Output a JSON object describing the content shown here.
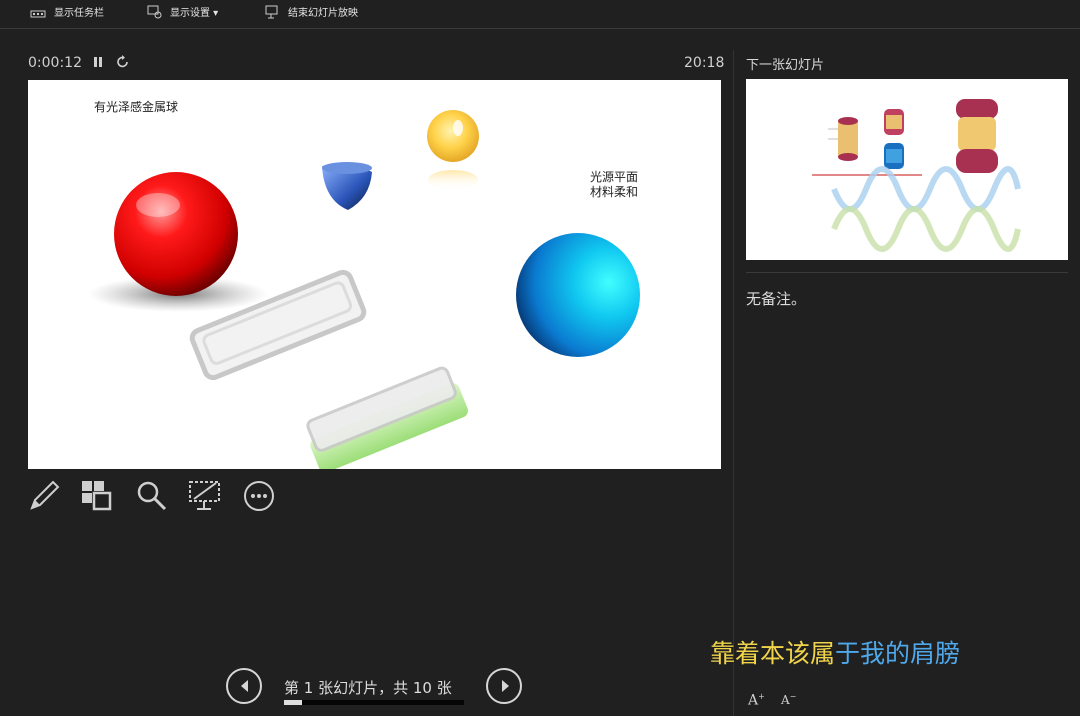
{
  "toolbar": {
    "show_taskbar": "显示任务栏",
    "display_settings": "显示设置 ▾",
    "end_show": "结束幻灯片放映"
  },
  "timer": {
    "elapsed": "0:00:12",
    "clock": "20:18"
  },
  "slide": {
    "label_metal": "有光泽感金属球",
    "label_light_1": "光源平面",
    "label_light_2": "材料柔和"
  },
  "tools": {
    "pen": "pen-icon",
    "slides": "all-slides-icon",
    "zoom": "zoom-icon",
    "screen": "black-screen-icon",
    "more": "more-options-icon"
  },
  "sidebar": {
    "next_slide_label": "下一张幻灯片",
    "notes": "无备注。",
    "font_increase": "A",
    "font_decrease": "A"
  },
  "subtitle": {
    "part1": "靠着本该属",
    "part2": "于我的肩膀"
  },
  "navigation": {
    "counter": "第 1 张幻灯片，共 10 张",
    "progress": 0.1
  },
  "colors": {
    "background": "#202020",
    "subtitle_yellow": "#f0d44a",
    "subtitle_blue": "#4fa8ea"
  }
}
